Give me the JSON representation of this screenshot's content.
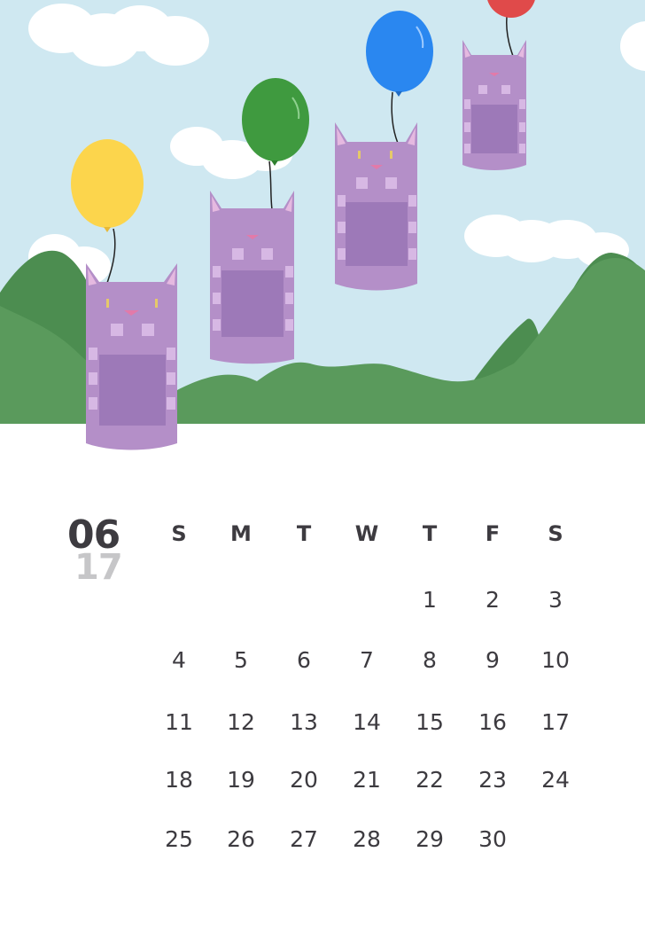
{
  "calendar": {
    "month": "06",
    "year": "17",
    "weekdays": [
      "S",
      "M",
      "T",
      "W",
      "T",
      "F",
      "S"
    ],
    "weeks": [
      [
        "",
        "",
        "",
        "",
        "1",
        "2",
        "3"
      ],
      [
        "4",
        "5",
        "6",
        "7",
        "8",
        "9",
        "10"
      ],
      [
        "11",
        "12",
        "13",
        "14",
        "15",
        "16",
        "17"
      ],
      [
        "18",
        "19",
        "20",
        "21",
        "22",
        "23",
        "24"
      ],
      [
        "25",
        "26",
        "27",
        "28",
        "29",
        "30",
        ""
      ]
    ]
  },
  "illustration": {
    "sky_color": "#cfe8f1",
    "hill_color": "#5a9a5c",
    "hill_dark_color": "#4c8d50",
    "cat_color": "#b48fc8",
    "balloons": [
      {
        "color": "#fcd54c",
        "icon": "yellow-balloon-icon"
      },
      {
        "color": "#3f9a3f",
        "icon": "green-balloon-icon"
      },
      {
        "color": "#2a87f0",
        "icon": "blue-balloon-icon"
      },
      {
        "color": "#e04a4a",
        "icon": "red-balloon-icon"
      }
    ]
  }
}
